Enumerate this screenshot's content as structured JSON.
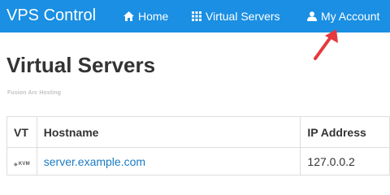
{
  "navbar": {
    "brand": "VPS Control",
    "items": [
      {
        "label": "Home",
        "icon": "home-icon"
      },
      {
        "label": "Virtual Servers",
        "icon": "grid-icon"
      },
      {
        "label": "My Account",
        "icon": "user-icon"
      }
    ]
  },
  "page": {
    "title": "Virtual Servers",
    "watermark": "Fusion Arc Hosting"
  },
  "table": {
    "headers": [
      "VT",
      "Hostname",
      "IP Address"
    ],
    "rows": [
      {
        "vt": "KVM",
        "hostname": "server.example.com",
        "ip": "127.0.0.2"
      }
    ]
  },
  "colors": {
    "navbar_bg": "#1a8fe3",
    "link": "#1a7bc4",
    "annotation_arrow": "#e5393c"
  }
}
